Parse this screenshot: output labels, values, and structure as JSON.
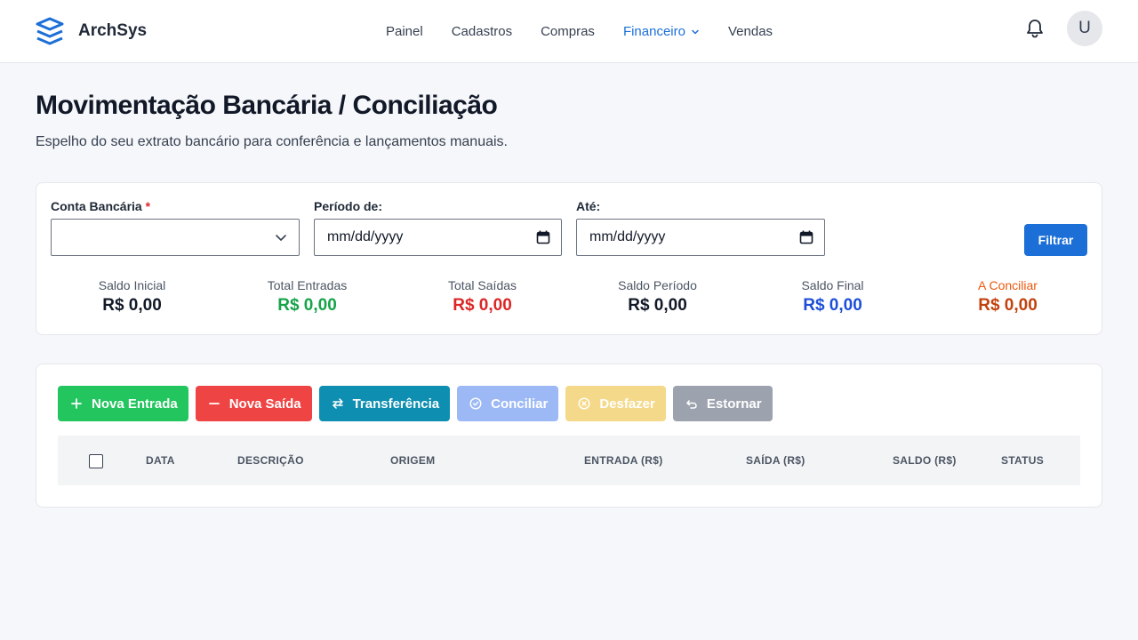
{
  "app": {
    "name": "ArchSys"
  },
  "nav": {
    "items": [
      {
        "label": "Painel"
      },
      {
        "label": "Cadastros"
      },
      {
        "label": "Compras"
      },
      {
        "label": "Financeiro",
        "active": true
      },
      {
        "label": "Vendas"
      }
    ]
  },
  "user": {
    "initial": "U"
  },
  "page": {
    "title": "Movimentação Bancária / Conciliação",
    "subtitle": "Espelho do seu extrato bancário para conferência e lançamentos manuais."
  },
  "filters": {
    "account_label": "Conta Bancária",
    "required_mark": "*",
    "account_value": "",
    "from_label": "Período de:",
    "from_value": "mm/dd/yyyy",
    "to_label": "Até:",
    "to_value": "mm/dd/yyyy",
    "filter_button": "Filtrar"
  },
  "stats": [
    {
      "label": "Saldo Inicial",
      "value": "R$ 0,00",
      "color": "#111827",
      "label_color": "#4b5563"
    },
    {
      "label": "Total Entradas",
      "value": "R$ 0,00",
      "color": "#16a34a",
      "label_color": "#4b5563"
    },
    {
      "label": "Total Saídas",
      "value": "R$ 0,00",
      "color": "#dc2626",
      "label_color": "#4b5563"
    },
    {
      "label": "Saldo Período",
      "value": "R$ 0,00",
      "color": "#111827",
      "label_color": "#4b5563"
    },
    {
      "label": "Saldo Final",
      "value": "R$ 0,00",
      "color": "#1d4ed8",
      "label_color": "#4b5563"
    },
    {
      "label": "A Conciliar",
      "value": "R$ 0,00",
      "color": "#c2410c",
      "label_color": "#ea580c"
    }
  ],
  "actions": [
    {
      "label": "Nova Entrada",
      "icon": "plus-icon",
      "color": "#22c55e"
    },
    {
      "label": "Nova Saída",
      "icon": "minus-icon",
      "color": "#ef4444"
    },
    {
      "label": "Transferência",
      "icon": "transfer-icon",
      "color": "#0e8fb1"
    },
    {
      "label": "Conciliar",
      "icon": "check-circle-icon",
      "color": "#9db9f5"
    },
    {
      "label": "Desfazer",
      "icon": "x-circle-icon",
      "color": "#f5d98a"
    },
    {
      "label": "Estornar",
      "icon": "undo-icon",
      "color": "#9ca3af"
    }
  ],
  "table": {
    "columns": [
      "DATA",
      "DESCRIÇÃO",
      "ORIGEM",
      "ENTRADA (R$)",
      "SAÍDA (R$)",
      "SALDO (R$)",
      "STATUS"
    ],
    "rows": []
  }
}
